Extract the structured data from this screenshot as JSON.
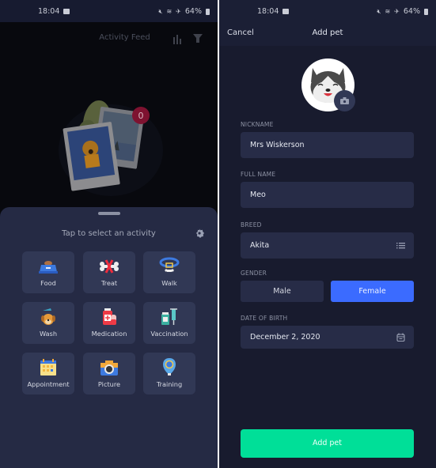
{
  "status_bar": {
    "time": "18:04",
    "battery": "64%"
  },
  "left_screen": {
    "header": {
      "title": "Activity Feed"
    },
    "illustration": {
      "badge_count": "0"
    },
    "sheet": {
      "title": "Tap to select an activity",
      "activities": [
        {
          "label": "Food",
          "icon": "food-bowl-icon"
        },
        {
          "label": "Treat",
          "icon": "bone-treat-icon"
        },
        {
          "label": "Walk",
          "icon": "collar-icon"
        },
        {
          "label": "Wash",
          "icon": "wash-icon"
        },
        {
          "label": "Medication",
          "icon": "medication-icon"
        },
        {
          "label": "Vaccination",
          "icon": "vaccine-icon"
        },
        {
          "label": "Appointment",
          "icon": "calendar-icon"
        },
        {
          "label": "Picture",
          "icon": "camera-icon"
        },
        {
          "label": "Training",
          "icon": "training-tag-icon"
        }
      ]
    }
  },
  "right_screen": {
    "header": {
      "cancel": "Cancel",
      "title": "Add pet"
    },
    "form": {
      "nickname": {
        "label": "NICKNAME",
        "value": "Mrs Wiskerson"
      },
      "full_name": {
        "label": "FULL NAME",
        "value": "Meo"
      },
      "breed": {
        "label": "BREED",
        "value": "Akita"
      },
      "gender": {
        "label": "GENDER",
        "options": [
          "Male",
          "Female"
        ],
        "selected": "Female"
      },
      "dob": {
        "label": "DATE OF BIRTH",
        "value": "December 2, 2020"
      }
    },
    "submit": "Add pet"
  },
  "colors": {
    "accent_blue": "#3b6bff",
    "accent_green": "#00df98",
    "badge_red": "#b0173a"
  }
}
